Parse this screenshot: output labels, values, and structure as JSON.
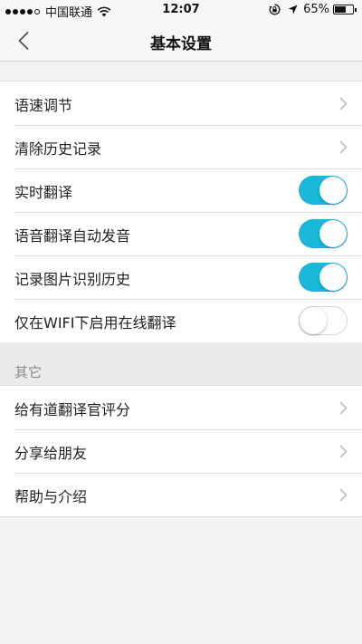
{
  "status_bar": {
    "carrier": "中国联通",
    "time": "12:07",
    "battery": "65%",
    "battery_level": 0.65
  },
  "nav": {
    "title": "基本设置"
  },
  "settings": [
    {
      "label": "语速调节",
      "control": "chevron"
    },
    {
      "label": "清除历史记录",
      "control": "chevron"
    },
    {
      "label": "实时翻译",
      "control": "toggle",
      "on": true
    },
    {
      "label": "语音翻译自动发音",
      "control": "toggle",
      "on": true
    },
    {
      "label": "记录图片识别历史",
      "control": "toggle",
      "on": true
    },
    {
      "label": "仅在WIFI下启用在线翻译",
      "control": "toggle",
      "on": false
    }
  ],
  "others": {
    "header": "其它",
    "items": [
      {
        "label": "给有道翻译官评分"
      },
      {
        "label": "分享给朋友"
      },
      {
        "label": "帮助与介绍"
      }
    ]
  },
  "colors": {
    "toggle_on": "#1ab8d8",
    "background": "#f2f2f2"
  }
}
